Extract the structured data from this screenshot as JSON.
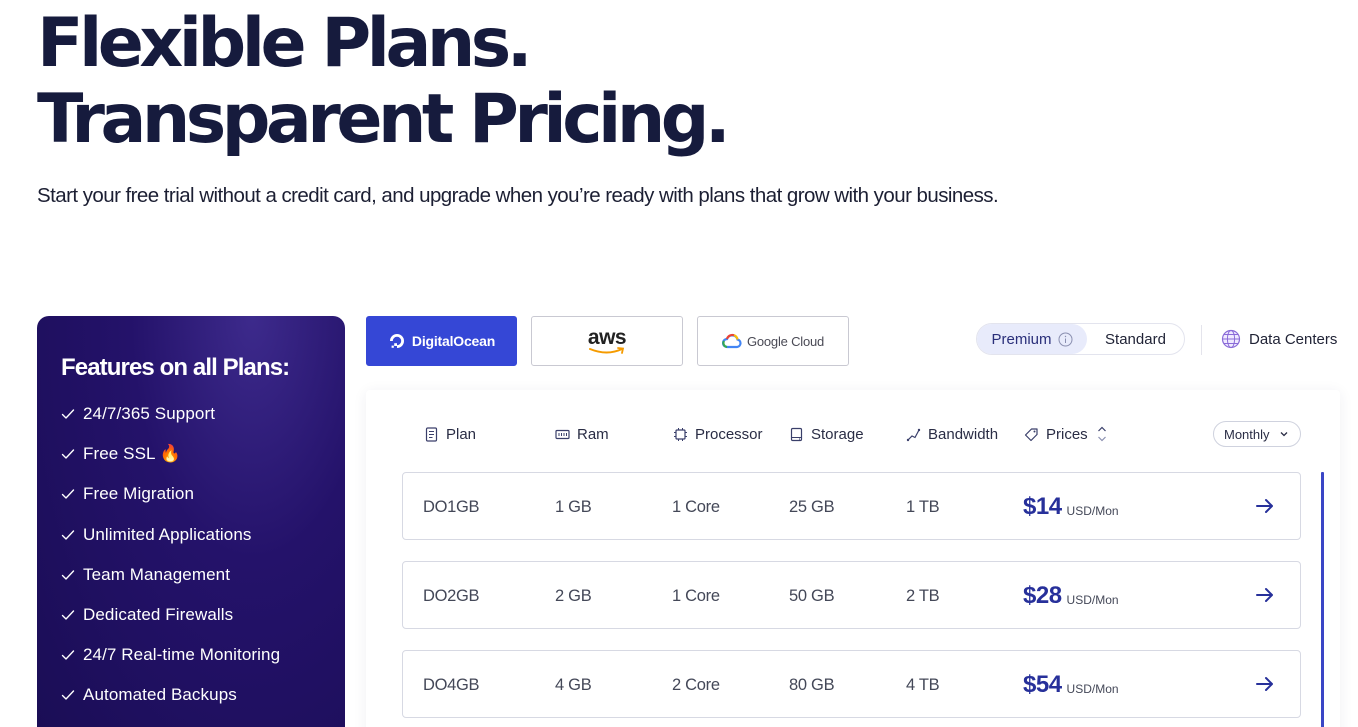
{
  "hero": {
    "title_line1": "Flexible Plans.",
    "title_line2": "Transparent Pricing.",
    "subtitle": "Start your free trial without a credit card, and upgrade when you’re ready with plans that grow with your business."
  },
  "features": {
    "title": "Features on all Plans:",
    "items": [
      "24/7/365 Support",
      "Free SSL 🔥",
      "Free Migration",
      "Unlimited Applications",
      "Team Management",
      "Dedicated Firewalls",
      "24/7 Real-time Monitoring",
      "Automated Backups"
    ]
  },
  "providers": {
    "digitalocean": "DigitalOcean",
    "aws": "aws",
    "googlecloud": "Google Cloud",
    "active": "DigitalOcean"
  },
  "tiers": {
    "premium": "Premium",
    "standard": "Standard",
    "active": "Premium"
  },
  "datacenters_label": "Data Centers",
  "table": {
    "headers": {
      "plan": "Plan",
      "ram": "Ram",
      "processor": "Processor",
      "storage": "Storage",
      "bandwidth": "Bandwidth",
      "prices": "Prices"
    },
    "billing_period": "Monthly",
    "price_unit": "USD/Mon",
    "rows": [
      {
        "plan": "DO1GB",
        "ram": "1 GB",
        "processor": "1 Core",
        "storage": "25 GB",
        "bandwidth": "1 TB",
        "price": "$14"
      },
      {
        "plan": "DO2GB",
        "ram": "2 GB",
        "processor": "1 Core",
        "storage": "50 GB",
        "bandwidth": "2 TB",
        "price": "$28"
      },
      {
        "plan": "DO4GB",
        "ram": "4 GB",
        "processor": "2 Core",
        "storage": "80 GB",
        "bandwidth": "4 TB",
        "price": "$54"
      }
    ]
  },
  "colors": {
    "primary": "#3547d6",
    "price": "#27309a",
    "heading": "#161b3d",
    "features_bg": "#1a0d55"
  }
}
